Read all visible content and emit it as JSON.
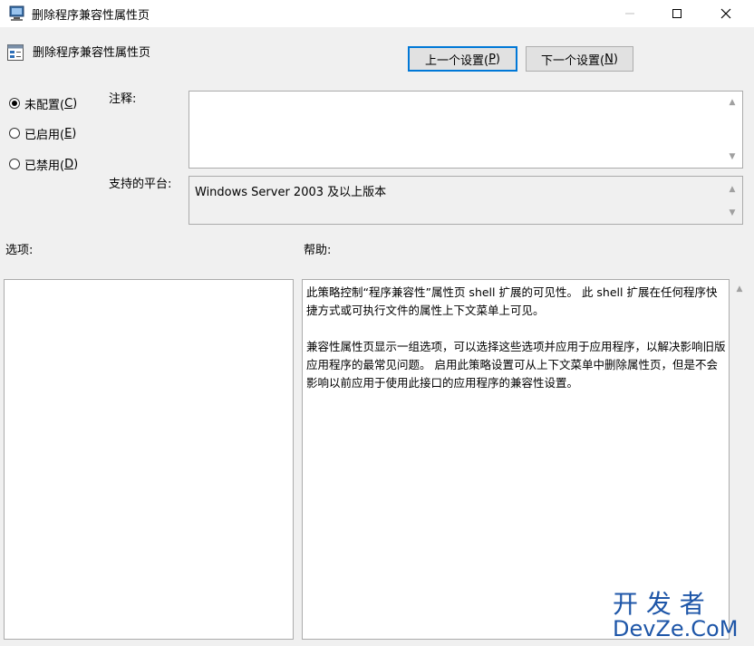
{
  "window": {
    "title": "删除程序兼容性属性页"
  },
  "header": {
    "policy_name": "删除程序兼容性属性页",
    "prev_button": {
      "text": "上一个设置(",
      "key": "P",
      "suffix": ")"
    },
    "next_button": {
      "text": "下一个设置(",
      "key": "N",
      "suffix": ")"
    }
  },
  "state": {
    "options": [
      {
        "label": "未配置(",
        "key": "C",
        "suffix": ")",
        "checked": true
      },
      {
        "label": "已启用(",
        "key": "E",
        "suffix": ")",
        "checked": false
      },
      {
        "label": "已禁用(",
        "key": "D",
        "suffix": ")",
        "checked": false
      }
    ]
  },
  "labels": {
    "comment": "注释:",
    "platform": "支持的平台:",
    "options": "选项:",
    "help": "帮助:"
  },
  "comment_value": "",
  "platform_value": "Windows Server 2003 及以上版本",
  "help_paragraphs": [
    "此策略控制“程序兼容性”属性页 shell 扩展的可见性。 此 shell 扩展在任何程序快捷方式或可执行文件的属性上下文菜单上可见。",
    "兼容性属性页显示一组选项，可以选择这些选项并应用于应用程序，以解决影响旧版应用程序的最常见问题。 启用此策略设置可从上下文菜单中删除属性页，但是不会影响以前应用于使用此接口的应用程序的兼容性设置。"
  ],
  "watermark": {
    "line1": "开 发 者",
    "line2": "DevZe.CoM"
  },
  "colors": {
    "accent": "#0078d7",
    "watermark": "#1e56a8"
  }
}
